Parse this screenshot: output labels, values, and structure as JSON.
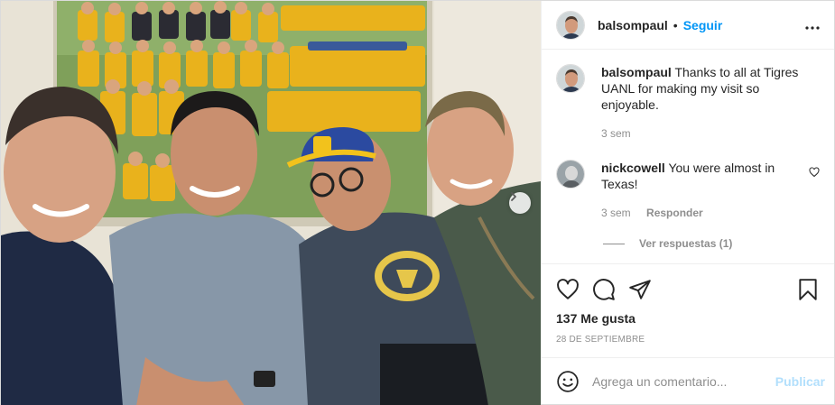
{
  "header": {
    "username": "balsompaul",
    "separator": "•",
    "follow_label": "Seguir",
    "more_icon": "more-horizontal-icon"
  },
  "caption": {
    "username": "balsompaul",
    "text": "Thanks to all at Tigres UANL for making my visit so enjoyable.",
    "time": "3 sem"
  },
  "comments": [
    {
      "username": "nickcowell",
      "text": "You were almost in Texas!",
      "time": "3 sem",
      "reply_label": "Responder",
      "view_replies_label": "Ver respuestas (1)"
    }
  ],
  "actions": {
    "like_icon": "heart-icon",
    "comment_icon": "comment-icon",
    "share_icon": "paper-plane-icon",
    "save_icon": "bookmark-icon",
    "likes_text": "137 Me gusta",
    "date": "28 DE SEPTIEMBRE"
  },
  "add_comment": {
    "placeholder": "Agrega un comentario...",
    "post_label": "Publicar"
  },
  "colors": {
    "link_blue": "#0095f6",
    "post_disabled": "#b2dffc",
    "secondary_text": "#8e8e8e"
  }
}
